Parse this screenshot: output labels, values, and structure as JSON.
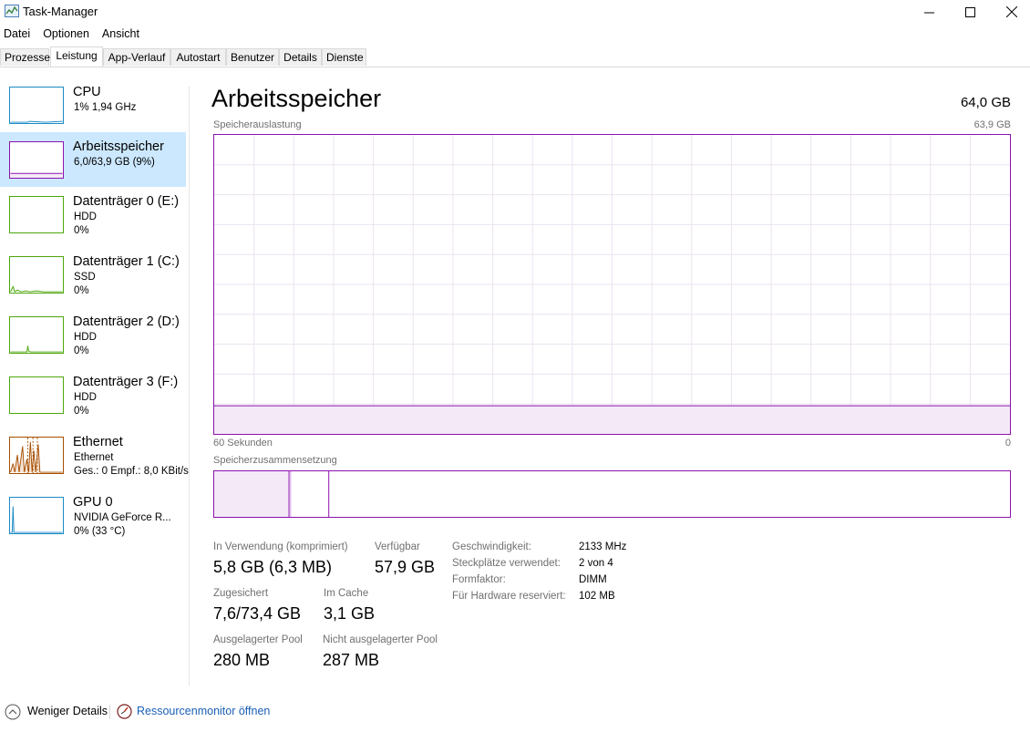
{
  "window": {
    "title": "Task-Manager"
  },
  "menu": [
    "Datei",
    "Optionen",
    "Ansicht"
  ],
  "tabs": [
    "Prozesse",
    "Leistung",
    "App-Verlauf",
    "Autostart",
    "Benutzer",
    "Details",
    "Dienste"
  ],
  "active_tab": "Leistung",
  "sidebar": {
    "items": [
      {
        "name": "CPU",
        "line1": "1% 1,94 GHz",
        "line2": "",
        "line3": "",
        "color": "#1b8ac4"
      },
      {
        "name": "Arbeitsspeicher",
        "line1": "6,0/63,9 GB (9%)",
        "line2": "",
        "line3": "",
        "color": "#8b12ae",
        "selected": true
      },
      {
        "name": "Datenträger 0 (E:)",
        "line1": "HDD",
        "line2": "0%",
        "line3": "",
        "color": "#4da60c"
      },
      {
        "name": "Datenträger 1 (C:)",
        "line1": "SSD",
        "line2": "0%",
        "line3": "",
        "color": "#4da60c"
      },
      {
        "name": "Datenträger 2 (D:)",
        "line1": "HDD",
        "line2": "0%",
        "line3": "",
        "color": "#4da60c"
      },
      {
        "name": "Datenträger 3 (F:)",
        "line1": "HDD",
        "line2": "0%",
        "line3": "",
        "color": "#4da60c"
      },
      {
        "name": "Ethernet",
        "line1": "Ethernet",
        "line2": "Ges.: 0 Empf.: 8,0 KBit/s",
        "line3": "",
        "color": "#a74f01"
      },
      {
        "name": "GPU 0",
        "line1": "NVIDIA GeForce R...",
        "line2": "0% (33 °C)",
        "line3": "",
        "color": "#1b8ac4"
      }
    ]
  },
  "main": {
    "title": "Arbeitsspeicher",
    "total": "64,0 GB",
    "graph_label": "Speicherauslastung",
    "graph_max": "63,9 GB",
    "graph_left": "60 Sekunden",
    "graph_right": "0",
    "graph_usage_fraction": 0.094,
    "composition_label": "Speicherzusammensetzung",
    "composition": {
      "in_use_fraction": 0.094,
      "modified_fraction": 0.002,
      "standby_fraction": 0.048
    },
    "stats": {
      "in_use_label": "In Verwendung (komprimiert)",
      "in_use_value": "5,8 GB (6,3 MB)",
      "available_label": "Verfügbar",
      "available_value": "57,9 GB",
      "committed_label": "Zugesichert",
      "committed_value": "7,6/73,4 GB",
      "cached_label": "Im Cache",
      "cached_value": "3,1 GB",
      "paged_label": "Ausgelagerter Pool",
      "paged_value": "280 MB",
      "nonpaged_label": "Nicht ausgelagerter Pool",
      "nonpaged_value": "287 MB"
    },
    "details": [
      {
        "key": "Geschwindigkeit:",
        "value": "2133 MHz"
      },
      {
        "key": "Steckplätze verwendet:",
        "value": "2 von 4"
      },
      {
        "key": "Formfaktor:",
        "value": "DIMM"
      },
      {
        "key": "Für Hardware reserviert:",
        "value": "102 MB"
      }
    ]
  },
  "footer": {
    "fewer_details": "Weniger Details",
    "resource_monitor": "Ressourcenmonitor öffnen"
  }
}
